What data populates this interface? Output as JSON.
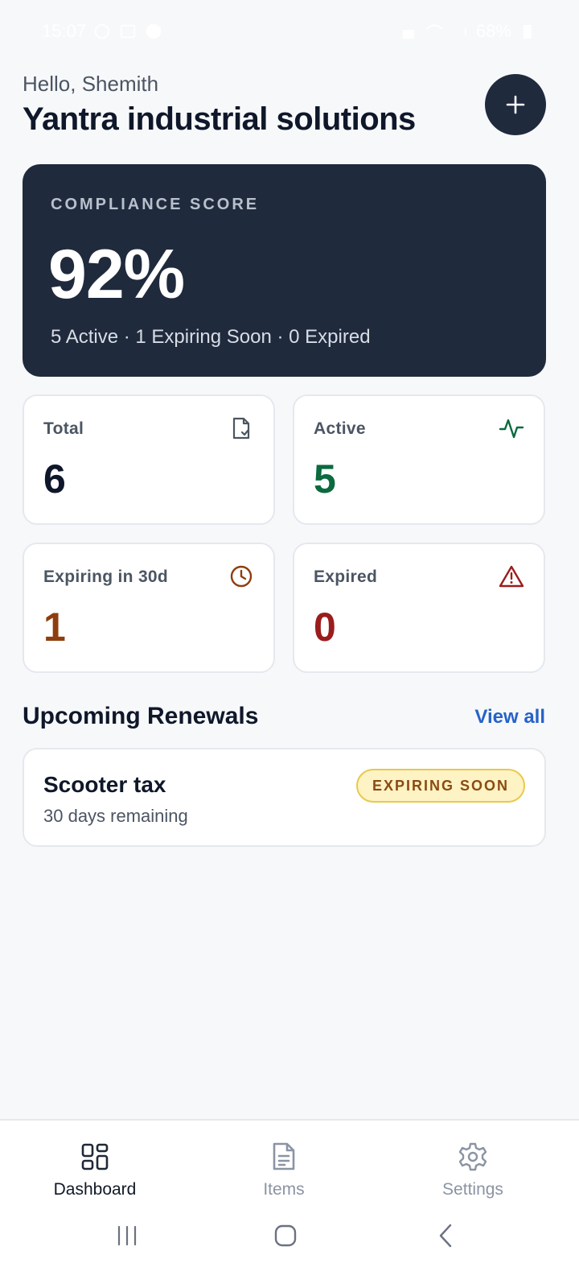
{
  "status_bar": {
    "time": "15:07",
    "battery": "68%"
  },
  "header": {
    "greeting": "Hello, Shemith",
    "company": "Yantra industrial solutions",
    "add_icon": "plus-icon"
  },
  "score_card": {
    "label": "COMPLIANCE SCORE",
    "value": "92%",
    "summary": "5 Active · 1 Expiring Soon · 0 Expired"
  },
  "stats": [
    {
      "label": "Total",
      "value": "6",
      "icon": "file-check-icon",
      "color": "#0f172a"
    },
    {
      "label": "Active",
      "value": "5",
      "icon": "activity-icon",
      "color": "#0b6a3e"
    },
    {
      "label": "Expiring in 30d",
      "value": "1",
      "icon": "clock-icon",
      "color": "#8f3d0e"
    },
    {
      "label": "Expired",
      "value": "0",
      "icon": "alert-triangle-icon",
      "color": "#9b1c1c"
    }
  ],
  "renewals": {
    "title": "Upcoming Renewals",
    "view_all": "View all",
    "items": [
      {
        "name": "Scooter tax",
        "remaining": "30 days remaining",
        "badge": "EXPIRING SOON"
      }
    ]
  },
  "bottom_nav": {
    "items": [
      {
        "label": "Dashboard",
        "icon": "grid-icon",
        "active": true
      },
      {
        "label": "Items",
        "icon": "document-icon",
        "active": false
      },
      {
        "label": "Settings",
        "icon": "gear-icon",
        "active": false
      }
    ]
  },
  "colors": {
    "dark_card": "#1f2a3d",
    "link": "#2563c9",
    "badge_bg": "#fdf3c4",
    "badge_text": "#8a4b12"
  }
}
